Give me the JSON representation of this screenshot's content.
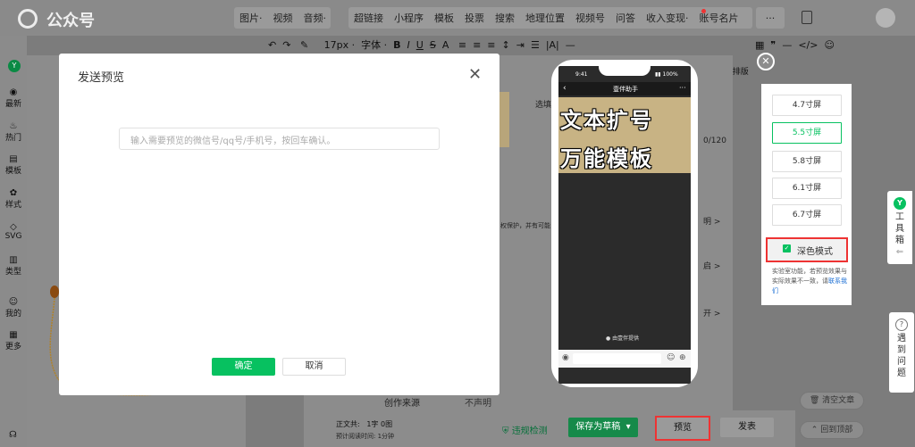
{
  "app": {
    "logo_text": "公众号"
  },
  "topmenu": {
    "group1": [
      "图片·",
      "视频",
      "音频·"
    ],
    "group2": [
      "超链接",
      "小程序",
      "模板",
      "投票",
      "搜索",
      "地理位置",
      "视频号",
      "问答",
      "收入变现·",
      "账号名片"
    ],
    "more": "···"
  },
  "toolbar": {
    "font_size": "17px ·",
    "font_family": "字体 ·",
    "ai_layout": "AI排版"
  },
  "sidebar": {
    "items": [
      {
        "icon": "◉",
        "label": "最新"
      },
      {
        "icon": "♨",
        "label": "热门"
      },
      {
        "icon": "▤",
        "label": "模板"
      },
      {
        "icon": "✿",
        "label": "样式"
      },
      {
        "icon": "◇",
        "label": "SVG"
      },
      {
        "icon": "▥",
        "label": "类型"
      },
      {
        "icon": "☺",
        "label": "我的"
      },
      {
        "icon": "▦",
        "label": "更多"
      }
    ]
  },
  "modal": {
    "title": "发送预览",
    "input_placeholder": "输入需要预览的微信号/qq号/手机号，按回车确认。",
    "confirm": "确定",
    "cancel": "取消"
  },
  "phone": {
    "time": "9:41",
    "battery": "100%",
    "nav_title": "壹伴助手",
    "banner_line1": "文本扩号",
    "banner_line2": "万能模板",
    "footer": "由壹伴提供"
  },
  "size_panel": {
    "sizes": [
      "4.7寸屏",
      "5.5寸屏",
      "5.8寸屏",
      "6.1寸屏",
      "6.7寸屏"
    ],
    "active_index": 1,
    "dark_mode_label": "深色模式",
    "dark_mode_checked": true,
    "note": "实验室功能，若预览效果与实际效果不一致，请",
    "note_link": "联系我们"
  },
  "toolbox": {
    "label_chars": [
      "工",
      "具",
      "箱"
    ]
  },
  "help": {
    "label_chars": [
      "遇",
      "到",
      "问",
      "题"
    ]
  },
  "bottom": {
    "word_count_label": "正文共:",
    "word_count_value": "1字 0图",
    "read_time_label": "预计阅读时间:",
    "read_time_value": "1分钟",
    "violation_check": "违规检测",
    "save_draft": "保存为草稿",
    "preview": "预览",
    "publish": "发表",
    "clear": "清空文章",
    "back_top": "回到顶部",
    "source_label": "创作来源",
    "source_value": "不声明"
  },
  "background_fragments": {
    "counter": "0/120",
    "select_label": "选填",
    "ming": "明 >",
    "qi": "启 >",
    "kai": "开 >",
    "copyright_text": "权保护，并有可能"
  },
  "colors": {
    "accent": "#07c160",
    "highlight": "#ee3333",
    "link": "#1c6fd4"
  }
}
